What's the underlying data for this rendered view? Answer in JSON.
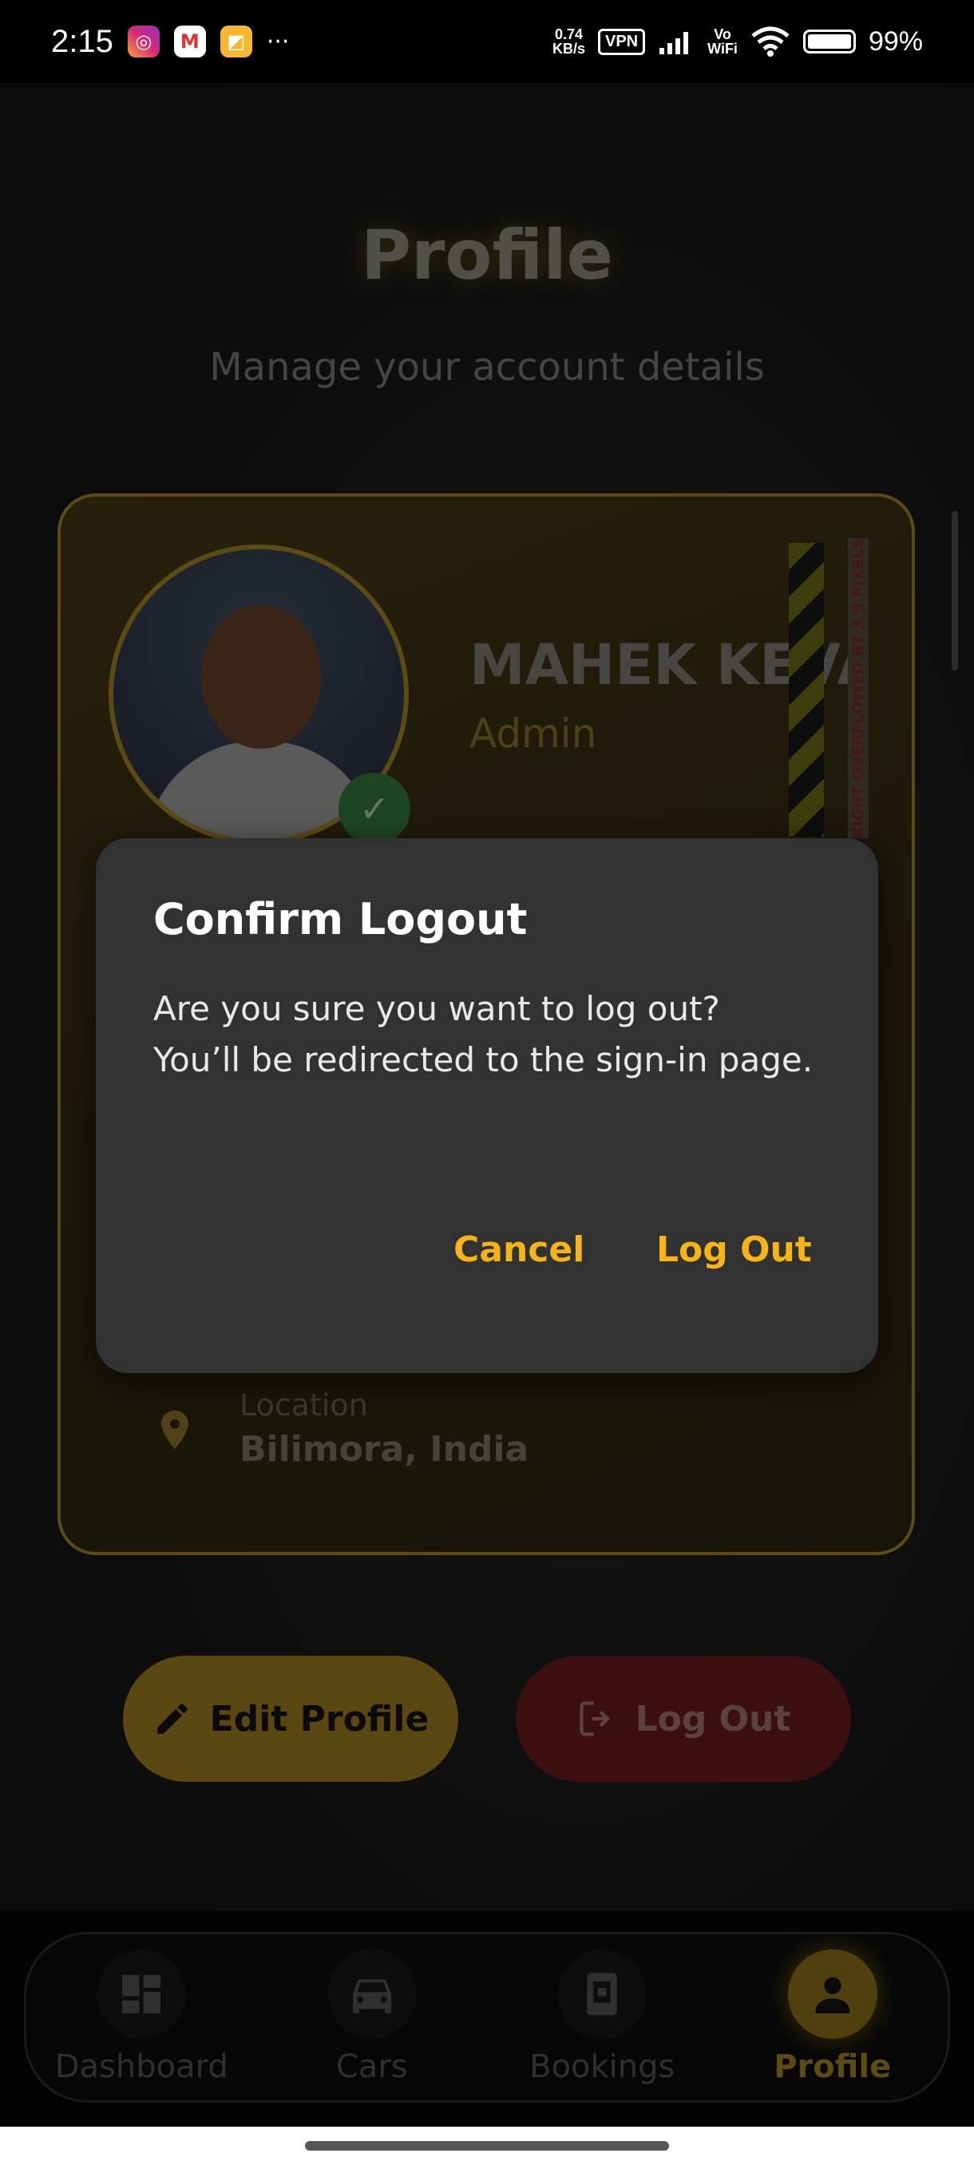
{
  "status_bar": {
    "time": "2:15",
    "net_speed_value": "0.74",
    "net_speed_unit": "KB/s",
    "vpn": "VPN",
    "volte_line1": "Vo",
    "volte_line2": "WiFi",
    "battery_percent": "99%",
    "more": "···"
  },
  "page": {
    "title": "Profile",
    "subtitle": "Manage your account details"
  },
  "profile_card": {
    "name": "MAHEK KEVAT",
    "role": "Admin",
    "overflow_warning": "RIGHT OVERFLOWED BY 3.9 PIXELS",
    "location_label": "Location",
    "location_value": "Bilimora, India"
  },
  "actions": {
    "edit_label": "Edit Profile",
    "logout_label": "Log Out"
  },
  "dialog": {
    "title": "Confirm Logout",
    "message": "Are you sure you want to log out? You’ll be redirected to the sign-in page.",
    "cancel_label": "Cancel",
    "confirm_label": "Log Out"
  },
  "nav": {
    "items": [
      {
        "label": "Dashboard",
        "icon": "dashboard-icon",
        "active": false
      },
      {
        "label": "Cars",
        "icon": "car-icon",
        "active": false
      },
      {
        "label": "Bookings",
        "icon": "booking-icon",
        "active": false
      },
      {
        "label": "Profile",
        "icon": "person-icon",
        "active": true
      }
    ]
  },
  "colors": {
    "accent": "#f4b41a",
    "card_border": "#8f7422",
    "logout_red": "#5c1a1a",
    "dialog_bg": "#323232"
  }
}
